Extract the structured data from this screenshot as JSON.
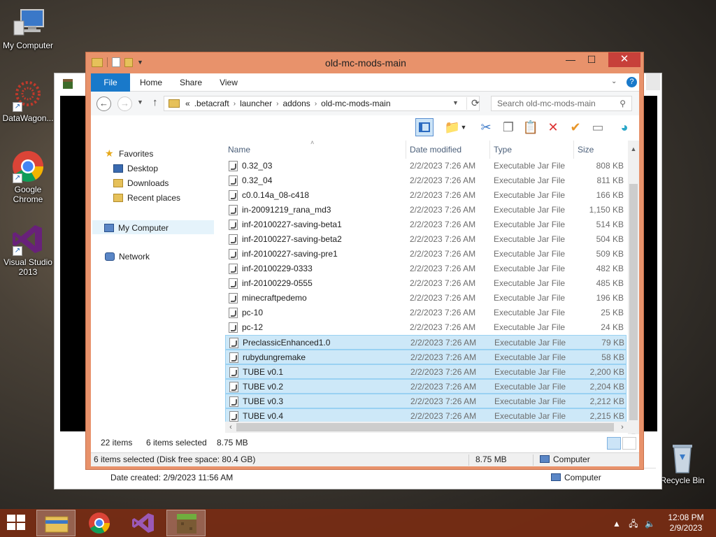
{
  "desktop": {
    "icons": [
      {
        "label": "My Computer",
        "icon": "computer-icon"
      },
      {
        "label": "DataWagon...",
        "icon": "datawagon-icon"
      },
      {
        "label": "Google Chrome",
        "icon": "chrome-icon"
      },
      {
        "label": "Visual Studio 2013",
        "icon": "visual-studio-icon"
      },
      {
        "label": "Recycle Bin",
        "icon": "recycle-bin-icon"
      }
    ]
  },
  "back_window": {
    "status_left": "Date created: 2/9/2023 11:56 AM",
    "status_right": "Computer"
  },
  "window": {
    "title": "old-mc-mods-main",
    "close_glyph": "✕",
    "minimize_glyph": "—",
    "maximize_glyph": "☐",
    "help_glyph": "?",
    "ribbon_tabs": [
      "File",
      "Home",
      "Share",
      "View"
    ],
    "address": {
      "prefix": "«",
      "crumbs": [
        ".betacraft",
        "launcher",
        "addons",
        "old-mc-mods-main"
      ]
    },
    "search_placeholder": "Search old-mc-mods-main",
    "nav_pane": {
      "favorites": "Favorites",
      "desktop": "Desktop",
      "downloads": "Downloads",
      "recent": "Recent places",
      "my_computer": "My Computer",
      "network": "Network"
    },
    "columns": {
      "name": "Name",
      "date": "Date modified",
      "type": "Type",
      "size": "Size"
    },
    "files": [
      {
        "name": "0.32_03",
        "date": "2/2/2023 7:26 AM",
        "type": "Executable Jar File",
        "size": "808 KB",
        "selected": false
      },
      {
        "name": "0.32_04",
        "date": "2/2/2023 7:26 AM",
        "type": "Executable Jar File",
        "size": "811 KB",
        "selected": false
      },
      {
        "name": "c0.0.14a_08-c418",
        "date": "2/2/2023 7:26 AM",
        "type": "Executable Jar File",
        "size": "166 KB",
        "selected": false
      },
      {
        "name": "in-20091219_rana_md3",
        "date": "2/2/2023 7:26 AM",
        "type": "Executable Jar File",
        "size": "1,150 KB",
        "selected": false
      },
      {
        "name": "inf-20100227-saving-beta1",
        "date": "2/2/2023 7:26 AM",
        "type": "Executable Jar File",
        "size": "514 KB",
        "selected": false
      },
      {
        "name": "inf-20100227-saving-beta2",
        "date": "2/2/2023 7:26 AM",
        "type": "Executable Jar File",
        "size": "504 KB",
        "selected": false
      },
      {
        "name": "inf-20100227-saving-pre1",
        "date": "2/2/2023 7:26 AM",
        "type": "Executable Jar File",
        "size": "509 KB",
        "selected": false
      },
      {
        "name": "inf-20100229-0333",
        "date": "2/2/2023 7:26 AM",
        "type": "Executable Jar File",
        "size": "482 KB",
        "selected": false
      },
      {
        "name": "inf-20100229-0555",
        "date": "2/2/2023 7:26 AM",
        "type": "Executable Jar File",
        "size": "485 KB",
        "selected": false
      },
      {
        "name": "minecraftpedemo",
        "date": "2/2/2023 7:26 AM",
        "type": "Executable Jar File",
        "size": "196 KB",
        "selected": false
      },
      {
        "name": "pc-10",
        "date": "2/2/2023 7:26 AM",
        "type": "Executable Jar File",
        "size": "25 KB",
        "selected": false
      },
      {
        "name": "pc-12",
        "date": "2/2/2023 7:26 AM",
        "type": "Executable Jar File",
        "size": "24 KB",
        "selected": false
      },
      {
        "name": "PreclassicEnhanced1.0",
        "date": "2/2/2023 7:26 AM",
        "type": "Executable Jar File",
        "size": "79 KB",
        "selected": true
      },
      {
        "name": "rubydungremake",
        "date": "2/2/2023 7:26 AM",
        "type": "Executable Jar File",
        "size": "58 KB",
        "selected": true
      },
      {
        "name": "TUBE v0.1",
        "date": "2/2/2023 7:26 AM",
        "type": "Executable Jar File",
        "size": "2,200 KB",
        "selected": true
      },
      {
        "name": "TUBE v0.2",
        "date": "2/2/2023 7:26 AM",
        "type": "Executable Jar File",
        "size": "2,204 KB",
        "selected": true
      },
      {
        "name": "TUBE v0.3",
        "date": "2/2/2023 7:26 AM",
        "type": "Executable Jar File",
        "size": "2,212 KB",
        "selected": true
      },
      {
        "name": "TUBE v0.4",
        "date": "2/2/2023 7:26 AM",
        "type": "Executable Jar File",
        "size": "2,215 KB",
        "selected": true
      }
    ],
    "details_bar": {
      "item_count": "22 items",
      "selected": "6 items selected",
      "size": "8.75 MB"
    },
    "status_bar": {
      "left": "6 items selected (Disk free space: 80.4 GB)",
      "size": "8.75 MB",
      "location": "Computer"
    }
  },
  "taskbar": {
    "apps": [
      "file-explorer-icon",
      "chrome-icon",
      "visual-studio-icon",
      "minecraft-icon"
    ],
    "time": "12:08 PM",
    "date": "2/9/2023"
  },
  "colors": {
    "titlebar": "#e8926b",
    "close": "#c7403a",
    "accent": "#1979ca",
    "selection": "#cde8f8",
    "taskbar": "#782c14"
  }
}
